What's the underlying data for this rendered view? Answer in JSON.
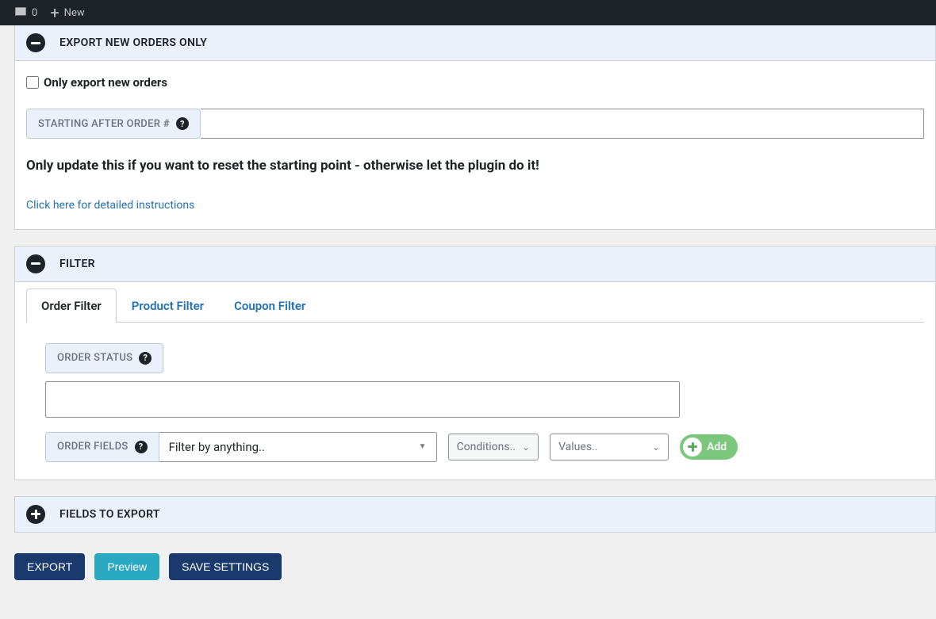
{
  "topbar": {
    "comment_count": "0",
    "new_label": "New"
  },
  "panel1": {
    "title": "EXPORT NEW ORDERS ONLY",
    "checkbox_label": "Only export new orders",
    "starting_label": "STARTING AFTER ORDER #",
    "starting_value": "",
    "info_text": "Only update this if you want to reset the starting point - otherwise let the plugin do it!",
    "instructions_link": "Click here for detailed instructions"
  },
  "panel2": {
    "title": "FILTER",
    "tabs": {
      "order": "Order Filter",
      "product": "Product Filter",
      "coupon": "Coupon Filter"
    },
    "order_status_label": "ORDER STATUS",
    "order_status_value": "",
    "order_fields_label": "ORDER FIELDS",
    "filter_placeholder": "Filter by anything..",
    "conditions_placeholder": "Conditions..",
    "values_placeholder": "Values..",
    "add_label": "Add"
  },
  "panel3": {
    "title": "FIELDS TO EXPORT"
  },
  "buttons": {
    "export": "EXPORT",
    "preview": "Preview",
    "save": "SAVE SETTINGS"
  }
}
